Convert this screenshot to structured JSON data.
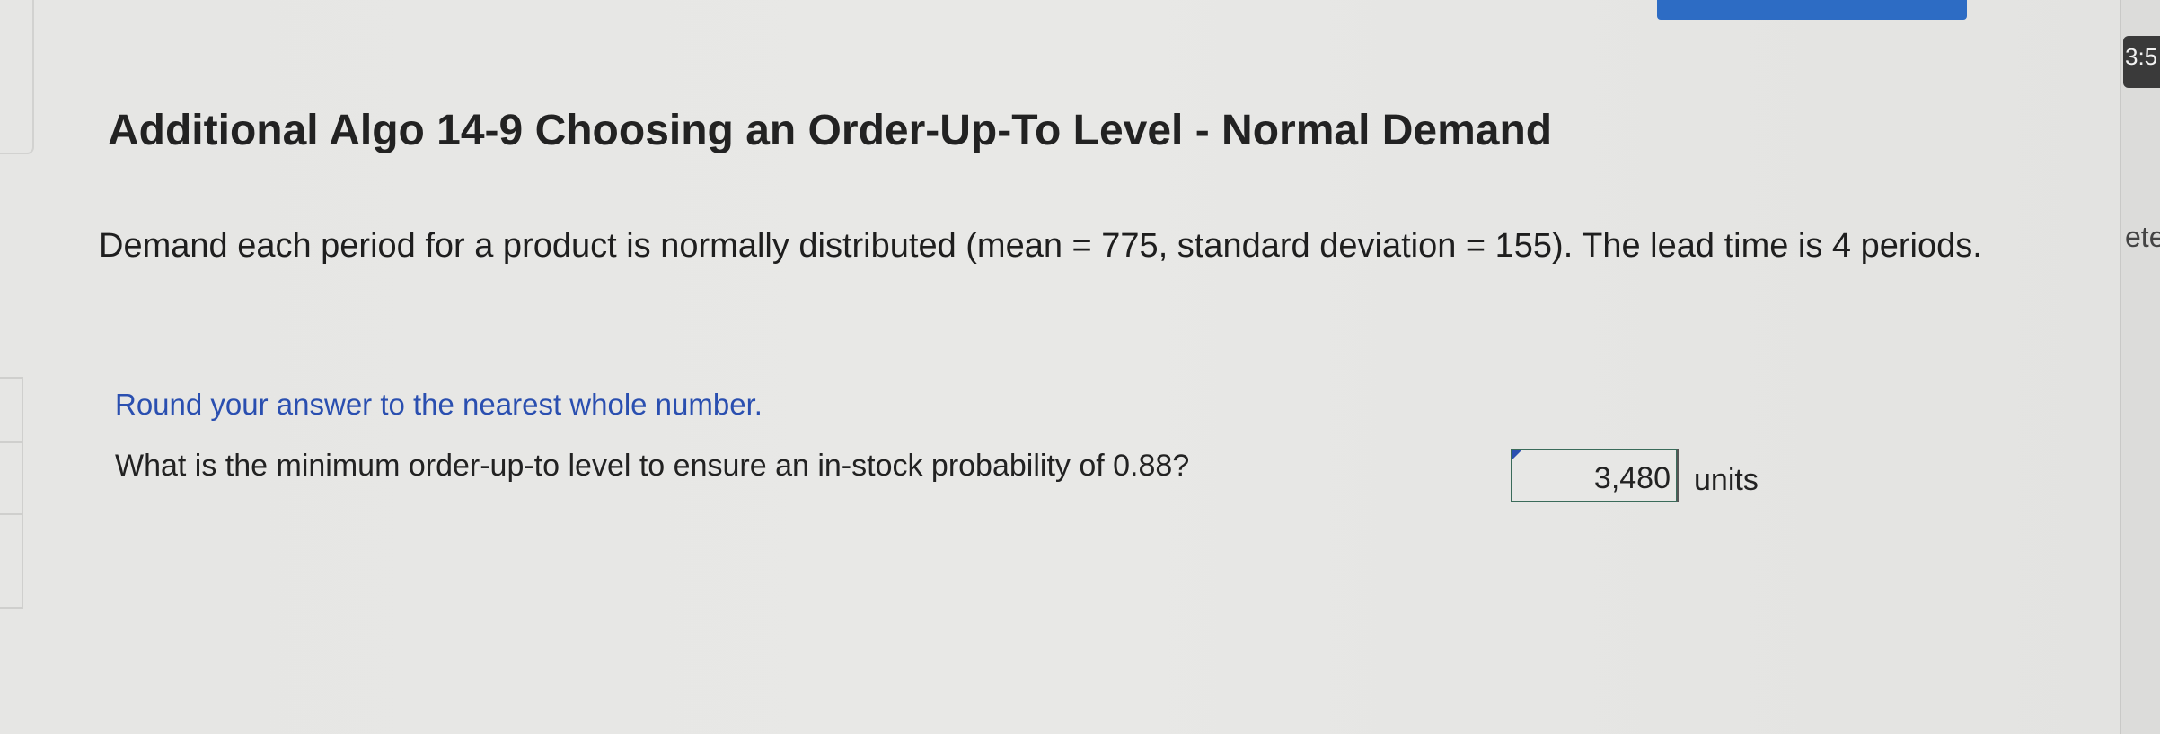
{
  "title": "Additional Algo 14-9 Choosing an Order-Up-To Level - Normal Demand",
  "problem": "Demand each period for a product is normally distributed (mean = 775, standard deviation = 155). The lead time is 4 periods.",
  "instruction": "Round your answer to the nearest whole number.",
  "question": "What is the minimum order-up-to level to ensure an in-stock probability of 0.88?",
  "answer": {
    "value": "3,480",
    "units": "units"
  },
  "right_panel": {
    "clock": "3:5",
    "label": "ete"
  },
  "colors": {
    "accent_blue": "#2d6cc4",
    "instruction_blue": "#2a4fb0",
    "answer_border": "#3a6b5a"
  }
}
